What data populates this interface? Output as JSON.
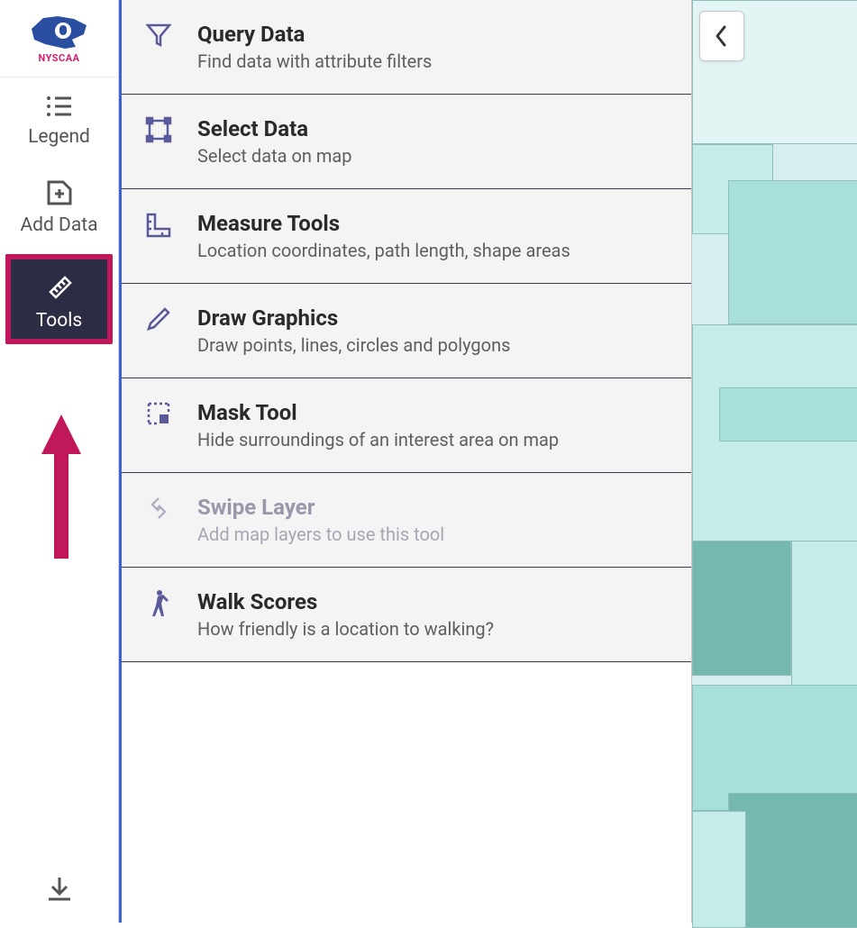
{
  "brand": {
    "name": "NYSCAA"
  },
  "rail": {
    "legend": "Legend",
    "add_data": "Add Data",
    "tools": "Tools"
  },
  "tools": [
    {
      "id": "query",
      "title": "Query Data",
      "desc": "Find data with attribute filters",
      "disabled": false
    },
    {
      "id": "select",
      "title": "Select Data",
      "desc": "Select data on map",
      "disabled": false
    },
    {
      "id": "measure",
      "title": "Measure Tools",
      "desc": "Location coordinates, path length, shape areas",
      "disabled": false
    },
    {
      "id": "draw",
      "title": "Draw Graphics",
      "desc": "Draw points, lines, circles and polygons",
      "disabled": false
    },
    {
      "id": "mask",
      "title": "Mask Tool",
      "desc": "Hide surroundings of an interest area on map",
      "disabled": false
    },
    {
      "id": "swipe",
      "title": "Swipe Layer",
      "desc": "Add map layers to use this tool",
      "disabled": true
    },
    {
      "id": "walk",
      "title": "Walk Scores",
      "desc": "How friendly is a location to walking?",
      "disabled": false
    }
  ]
}
